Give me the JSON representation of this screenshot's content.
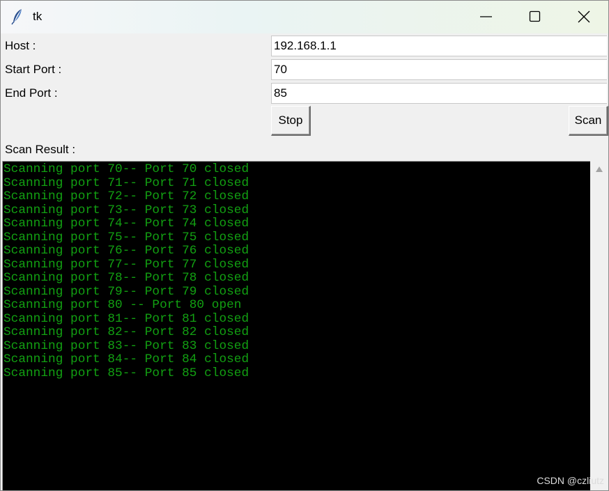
{
  "window": {
    "title": "tk",
    "app_icon": "feather-icon",
    "controls": [
      "minimize-icon",
      "maximize-icon",
      "close-icon"
    ]
  },
  "form": {
    "host_label": "Host :",
    "host_value": "192.168.1.1",
    "start_port_label": "Start Port :",
    "start_port_value": "70",
    "end_port_label": "End Port :",
    "end_port_value": "85",
    "stop_label": "Stop",
    "scan_label": "Scan",
    "result_label": "Scan Result :"
  },
  "results": [
    "Scanning port 70-- Port 70 closed",
    "Scanning port 71-- Port 71 closed",
    "Scanning port 72-- Port 72 closed",
    "Scanning port 73-- Port 73 closed",
    "Scanning port 74-- Port 74 closed",
    "Scanning port 75-- Port 75 closed",
    "Scanning port 76-- Port 76 closed",
    "Scanning port 77-- Port 77 closed",
    "Scanning port 78-- Port 78 closed",
    "Scanning port 79-- Port 79 closed",
    "Scanning port 80 -- Port 80 open",
    "Scanning port 81-- Port 81 closed",
    "Scanning port 82-- Port 82 closed",
    "Scanning port 83-- Port 83 closed",
    "Scanning port 84-- Port 84 closed",
    "Scanning port 85-- Port 85 closed"
  ],
  "colors": {
    "console_background": "#000000",
    "console_text": "#12a012"
  },
  "watermark": "CSDN @czliutz"
}
